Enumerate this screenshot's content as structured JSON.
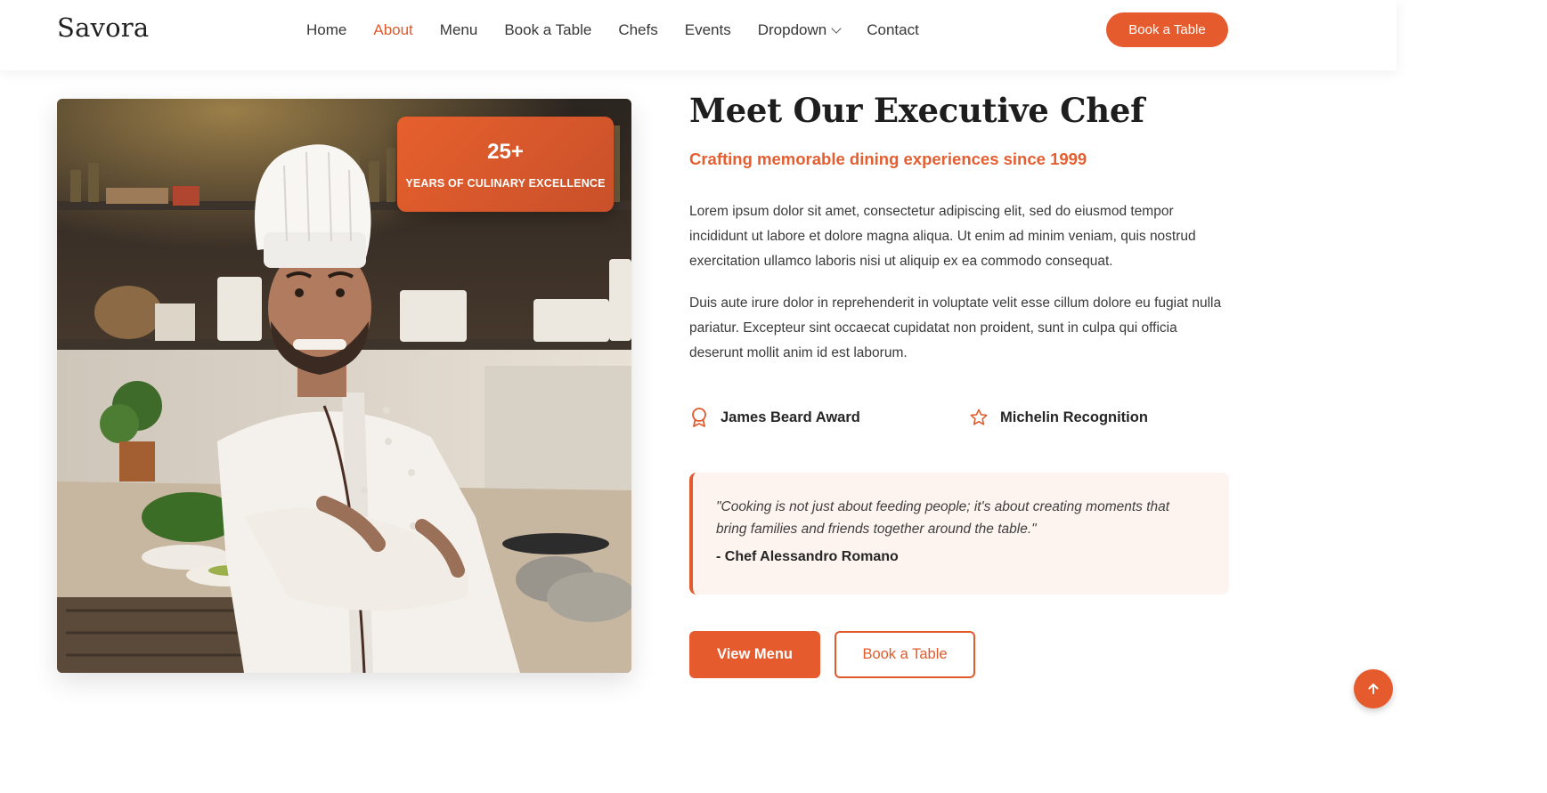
{
  "brand": {
    "name": "Savora",
    "accent": "#e65b2e"
  },
  "nav": {
    "items": [
      {
        "label": "Home",
        "active": false
      },
      {
        "label": "About",
        "active": true
      },
      {
        "label": "Menu",
        "active": false
      },
      {
        "label": "Book a Table",
        "active": false
      },
      {
        "label": "Chefs",
        "active": false
      },
      {
        "label": "Events",
        "active": false
      },
      {
        "label": "Dropdown",
        "active": false,
        "icon": "chevron-down-icon"
      },
      {
        "label": "Contact",
        "active": false
      }
    ],
    "cta_label": "Book a Table"
  },
  "hero_image": {
    "alt": "Chef in white uniform with arms crossed in a restaurant kitchen"
  },
  "badge": {
    "number": "25+",
    "label": "YEARS OF CULINARY EXCELLENCE"
  },
  "about": {
    "title": "Meet Our Executive Chef",
    "subtitle": "Crafting memorable dining experiences since 1999",
    "paragraph1": "Lorem ipsum dolor sit amet, consectetur adipiscing elit, sed do eiusmod tempor incididunt ut labore et dolore magna aliqua. Ut enim ad minim veniam, quis nostrud exercitation ullamco laboris nisi ut aliquip ex ea commodo consequat.",
    "paragraph2": "Duis aute irure dolor in reprehenderit in voluptate velit esse cillum dolore eu fugiat nulla pariatur. Excepteur sint occaecat cupidatat non proident, sunt in culpa qui officia deserunt mollit anim id est laborum.",
    "awards": [
      {
        "label": "James Beard Award",
        "icon": "award-icon"
      },
      {
        "label": "Michelin Recognition",
        "icon": "star-icon"
      }
    ],
    "quote": {
      "text": "\"Cooking is not just about feeding people; it's about creating moments that bring families and friends together around the table.\"",
      "author": "- Chef Alessandro Romano"
    },
    "buttons": {
      "primary": "View Menu",
      "secondary": "Book a Table"
    }
  },
  "scroll_top": {
    "icon": "arrow-up-icon"
  }
}
